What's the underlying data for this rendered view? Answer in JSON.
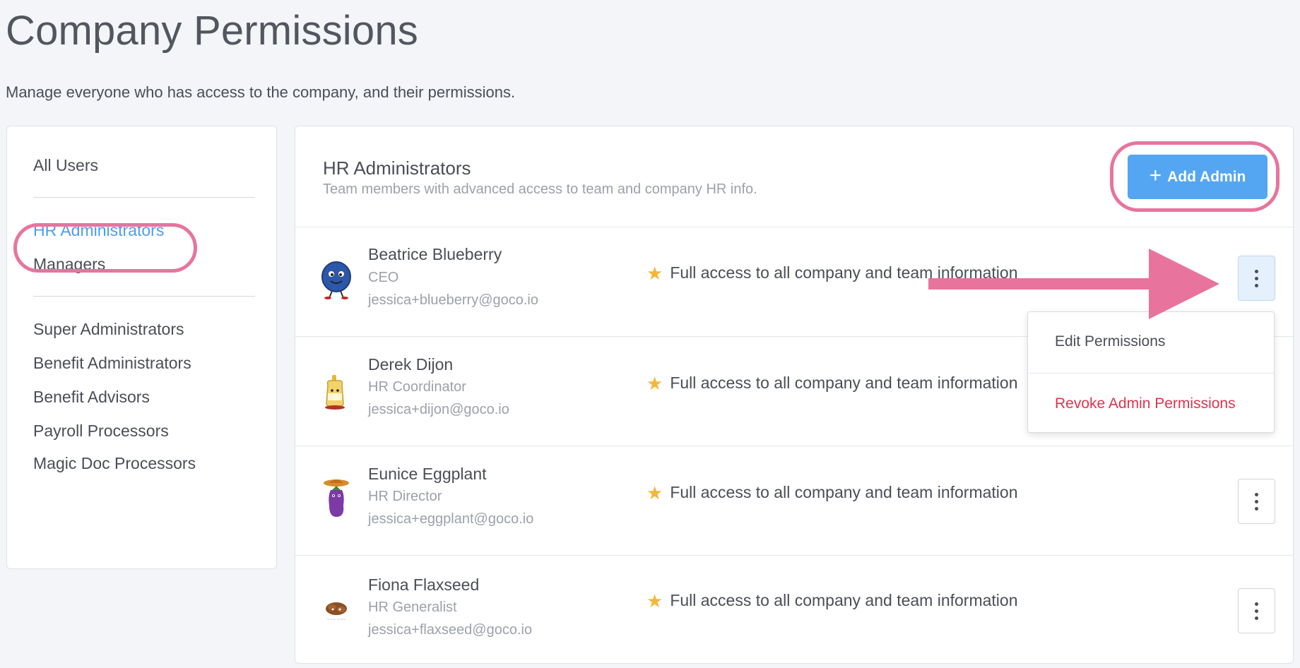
{
  "page": {
    "title": "Company Permissions",
    "subtitle": "Manage everyone who has access to the company, and their permissions."
  },
  "sidebar": {
    "items": [
      {
        "label": "All Users",
        "active": false
      },
      {
        "label": "HR Administrators",
        "active": true
      },
      {
        "label": "Managers",
        "active": false
      },
      {
        "label": "Super Administrators",
        "active": false
      },
      {
        "label": "Benefit Administrators",
        "active": false
      },
      {
        "label": "Benefit Advisors",
        "active": false
      },
      {
        "label": "Payroll Processors",
        "active": false
      },
      {
        "label": "Magic Doc Processors",
        "active": false
      }
    ]
  },
  "panel": {
    "title": "HR Administrators",
    "description": "Team members with advanced access to team and company HR info.",
    "add_button_label": "Add Admin",
    "add_button_icon": "plus-icon"
  },
  "members": [
    {
      "name": "Beatrice Blueberry",
      "role": "CEO",
      "email": "jessica+blueberry@goco.io",
      "access": "Full access to all company and team information",
      "avatar": "blueberry-avatar",
      "menu_open": true
    },
    {
      "name": "Derek Dijon",
      "role": "HR Coordinator",
      "email": "jessica+dijon@goco.io",
      "access": "Full access to all company and team information",
      "avatar": "dijon-avatar",
      "menu_open": false
    },
    {
      "name": "Eunice Eggplant",
      "role": "HR Director",
      "email": "jessica+eggplant@goco.io",
      "access": "Full access to all company and team information",
      "avatar": "eggplant-avatar",
      "menu_open": false
    },
    {
      "name": "Fiona Flaxseed",
      "role": "HR Generalist",
      "email": "jessica+flaxseed@goco.io",
      "access": "Full access to all company and team information",
      "avatar": "flaxseed-avatar",
      "menu_open": false
    }
  ],
  "dropdown": {
    "edit_label": "Edit Permissions",
    "revoke_label": "Revoke Admin Permissions"
  },
  "colors": {
    "accent": "#4a9ff0",
    "button": "#55a6f2",
    "highlight": "#e8749e",
    "star": "#f4b73b",
    "danger": "#e0334f"
  }
}
